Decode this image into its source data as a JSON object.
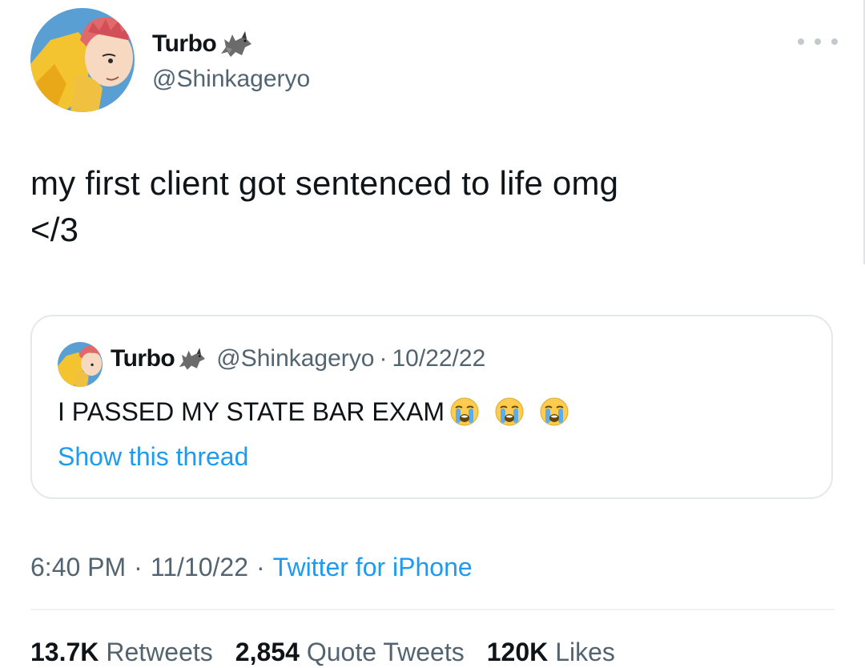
{
  "author": {
    "name": "Turbo",
    "handle": "@Shinkageryo",
    "badge_icon": "wolf-icon",
    "avatar_icon": "anime-avatar-icon"
  },
  "tweet": {
    "text": "my first client got sentenced to life omg\n</3"
  },
  "quoted_tweet": {
    "name": "Turbo",
    "handle": "@Shinkageryo",
    "separator": "·",
    "date": "10/22/22",
    "text": "I PASSED MY STATE BAR EXAM",
    "emojis": [
      "loudly-crying-face-icon",
      "loudly-crying-face-icon",
      "loudly-crying-face-icon"
    ],
    "show_thread_label": "Show this thread"
  },
  "meta": {
    "time": "6:40 PM",
    "separator": "·",
    "date": "11/10/22",
    "source": "Twitter for iPhone"
  },
  "stats": [
    {
      "count": "13.7K",
      "label": "Retweets"
    },
    {
      "count": "2,854",
      "label": "Quote Tweets"
    },
    {
      "count": "120K",
      "label": "Likes"
    }
  ],
  "colors": {
    "text_primary": "#0f1419",
    "text_secondary": "#536471",
    "link": "#1d9bf0",
    "border": "#e5e8eb"
  }
}
